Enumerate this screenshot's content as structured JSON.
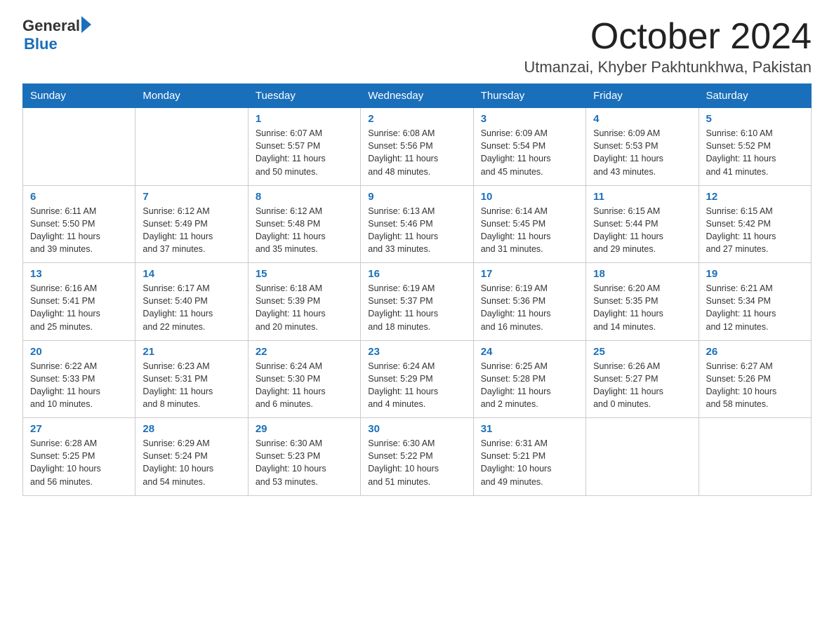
{
  "header": {
    "logo_general": "General",
    "logo_blue": "Blue",
    "month": "October 2024",
    "location": "Utmanzai, Khyber Pakhtunkhwa, Pakistan"
  },
  "days_of_week": [
    "Sunday",
    "Monday",
    "Tuesday",
    "Wednesday",
    "Thursday",
    "Friday",
    "Saturday"
  ],
  "weeks": [
    [
      {
        "day": "",
        "info": ""
      },
      {
        "day": "",
        "info": ""
      },
      {
        "day": "1",
        "info": "Sunrise: 6:07 AM\nSunset: 5:57 PM\nDaylight: 11 hours\nand 50 minutes."
      },
      {
        "day": "2",
        "info": "Sunrise: 6:08 AM\nSunset: 5:56 PM\nDaylight: 11 hours\nand 48 minutes."
      },
      {
        "day": "3",
        "info": "Sunrise: 6:09 AM\nSunset: 5:54 PM\nDaylight: 11 hours\nand 45 minutes."
      },
      {
        "day": "4",
        "info": "Sunrise: 6:09 AM\nSunset: 5:53 PM\nDaylight: 11 hours\nand 43 minutes."
      },
      {
        "day": "5",
        "info": "Sunrise: 6:10 AM\nSunset: 5:52 PM\nDaylight: 11 hours\nand 41 minutes."
      }
    ],
    [
      {
        "day": "6",
        "info": "Sunrise: 6:11 AM\nSunset: 5:50 PM\nDaylight: 11 hours\nand 39 minutes."
      },
      {
        "day": "7",
        "info": "Sunrise: 6:12 AM\nSunset: 5:49 PM\nDaylight: 11 hours\nand 37 minutes."
      },
      {
        "day": "8",
        "info": "Sunrise: 6:12 AM\nSunset: 5:48 PM\nDaylight: 11 hours\nand 35 minutes."
      },
      {
        "day": "9",
        "info": "Sunrise: 6:13 AM\nSunset: 5:46 PM\nDaylight: 11 hours\nand 33 minutes."
      },
      {
        "day": "10",
        "info": "Sunrise: 6:14 AM\nSunset: 5:45 PM\nDaylight: 11 hours\nand 31 minutes."
      },
      {
        "day": "11",
        "info": "Sunrise: 6:15 AM\nSunset: 5:44 PM\nDaylight: 11 hours\nand 29 minutes."
      },
      {
        "day": "12",
        "info": "Sunrise: 6:15 AM\nSunset: 5:42 PM\nDaylight: 11 hours\nand 27 minutes."
      }
    ],
    [
      {
        "day": "13",
        "info": "Sunrise: 6:16 AM\nSunset: 5:41 PM\nDaylight: 11 hours\nand 25 minutes."
      },
      {
        "day": "14",
        "info": "Sunrise: 6:17 AM\nSunset: 5:40 PM\nDaylight: 11 hours\nand 22 minutes."
      },
      {
        "day": "15",
        "info": "Sunrise: 6:18 AM\nSunset: 5:39 PM\nDaylight: 11 hours\nand 20 minutes."
      },
      {
        "day": "16",
        "info": "Sunrise: 6:19 AM\nSunset: 5:37 PM\nDaylight: 11 hours\nand 18 minutes."
      },
      {
        "day": "17",
        "info": "Sunrise: 6:19 AM\nSunset: 5:36 PM\nDaylight: 11 hours\nand 16 minutes."
      },
      {
        "day": "18",
        "info": "Sunrise: 6:20 AM\nSunset: 5:35 PM\nDaylight: 11 hours\nand 14 minutes."
      },
      {
        "day": "19",
        "info": "Sunrise: 6:21 AM\nSunset: 5:34 PM\nDaylight: 11 hours\nand 12 minutes."
      }
    ],
    [
      {
        "day": "20",
        "info": "Sunrise: 6:22 AM\nSunset: 5:33 PM\nDaylight: 11 hours\nand 10 minutes."
      },
      {
        "day": "21",
        "info": "Sunrise: 6:23 AM\nSunset: 5:31 PM\nDaylight: 11 hours\nand 8 minutes."
      },
      {
        "day": "22",
        "info": "Sunrise: 6:24 AM\nSunset: 5:30 PM\nDaylight: 11 hours\nand 6 minutes."
      },
      {
        "day": "23",
        "info": "Sunrise: 6:24 AM\nSunset: 5:29 PM\nDaylight: 11 hours\nand 4 minutes."
      },
      {
        "day": "24",
        "info": "Sunrise: 6:25 AM\nSunset: 5:28 PM\nDaylight: 11 hours\nand 2 minutes."
      },
      {
        "day": "25",
        "info": "Sunrise: 6:26 AM\nSunset: 5:27 PM\nDaylight: 11 hours\nand 0 minutes."
      },
      {
        "day": "26",
        "info": "Sunrise: 6:27 AM\nSunset: 5:26 PM\nDaylight: 10 hours\nand 58 minutes."
      }
    ],
    [
      {
        "day": "27",
        "info": "Sunrise: 6:28 AM\nSunset: 5:25 PM\nDaylight: 10 hours\nand 56 minutes."
      },
      {
        "day": "28",
        "info": "Sunrise: 6:29 AM\nSunset: 5:24 PM\nDaylight: 10 hours\nand 54 minutes."
      },
      {
        "day": "29",
        "info": "Sunrise: 6:30 AM\nSunset: 5:23 PM\nDaylight: 10 hours\nand 53 minutes."
      },
      {
        "day": "30",
        "info": "Sunrise: 6:30 AM\nSunset: 5:22 PM\nDaylight: 10 hours\nand 51 minutes."
      },
      {
        "day": "31",
        "info": "Sunrise: 6:31 AM\nSunset: 5:21 PM\nDaylight: 10 hours\nand 49 minutes."
      },
      {
        "day": "",
        "info": ""
      },
      {
        "day": "",
        "info": ""
      }
    ]
  ]
}
